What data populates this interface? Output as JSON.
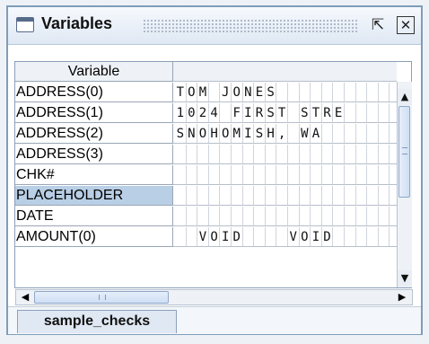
{
  "window": {
    "title": "Variables",
    "maximize_icon": "maximize-icon",
    "close_icon": "close-icon"
  },
  "table": {
    "column_header": "Variable",
    "value_header": "",
    "selected_row": "PLACEHOLDER",
    "rows": [
      {
        "label": "ADDRESS(0)",
        "chars": [
          "T",
          "O",
          "M",
          " ",
          "J",
          "O",
          "N",
          "E",
          "S",
          " ",
          " ",
          " ",
          " ",
          " ",
          " ",
          " ",
          " ",
          " "
        ]
      },
      {
        "label": "ADDRESS(1)",
        "chars": [
          "1",
          "0",
          "2",
          "4",
          " ",
          "F",
          "I",
          "R",
          "S",
          "T",
          " ",
          "S",
          "T",
          "R",
          "E",
          " ",
          " ",
          " "
        ]
      },
      {
        "label": "ADDRESS(2)",
        "chars": [
          "S",
          "N",
          "O",
          "H",
          "O",
          "M",
          "I",
          "S",
          "H",
          ",",
          " ",
          "W",
          "A",
          " ",
          " ",
          " ",
          " ",
          " "
        ]
      },
      {
        "label": "ADDRESS(3)",
        "chars": []
      },
      {
        "label": "CHK#",
        "chars": []
      },
      {
        "label": "PLACEHOLDER",
        "chars": []
      },
      {
        "label": "DATE",
        "chars": []
      },
      {
        "label": "AMOUNT(0)",
        "chars": [
          " ",
          " ",
          "V",
          "O",
          "I",
          "D",
          " ",
          " ",
          " ",
          " ",
          "V",
          "O",
          "I",
          "D",
          " ",
          " ",
          " ",
          " "
        ]
      }
    ]
  },
  "tabs": [
    {
      "label": "sample_checks",
      "active": true
    }
  ],
  "colors": {
    "selection": "#b8cfe5",
    "border": "#7f9db9"
  }
}
